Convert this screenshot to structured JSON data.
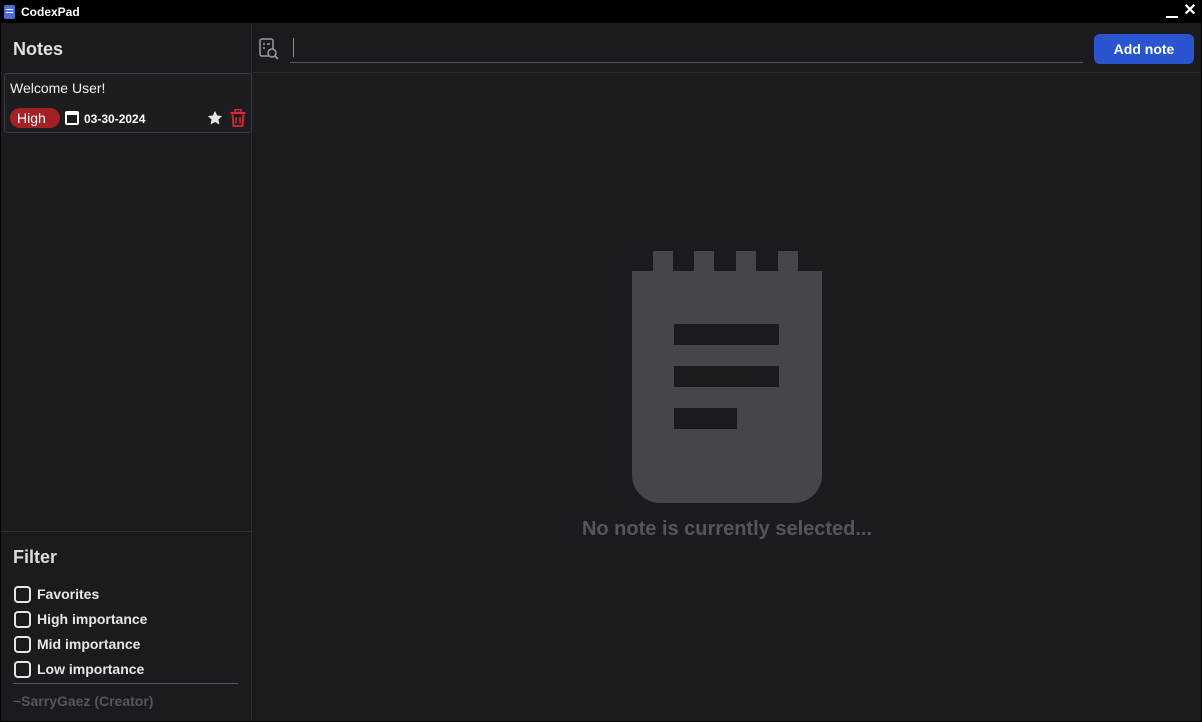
{
  "window": {
    "title": "CodexPad",
    "close_glyph": "✕"
  },
  "sidebar": {
    "title": "Notes",
    "notes": [
      {
        "title": "Welcome User!",
        "priority": "High",
        "date": "03-30-2024"
      }
    ]
  },
  "filter": {
    "title": "Filter",
    "options": [
      "Favorites",
      "High importance",
      "Mid importance",
      "Low importance"
    ],
    "credit": "~SarryGaez (Creator)"
  },
  "toolbar": {
    "search_value": "",
    "add_label": "Add note"
  },
  "main": {
    "empty_message": "No note is currently selected..."
  },
  "colors": {
    "background": "#1b1b1f",
    "accent": "#2b54d0",
    "priority_high": "#a32024",
    "muted": "#55555c",
    "placeholder_icon": "#45454b"
  }
}
